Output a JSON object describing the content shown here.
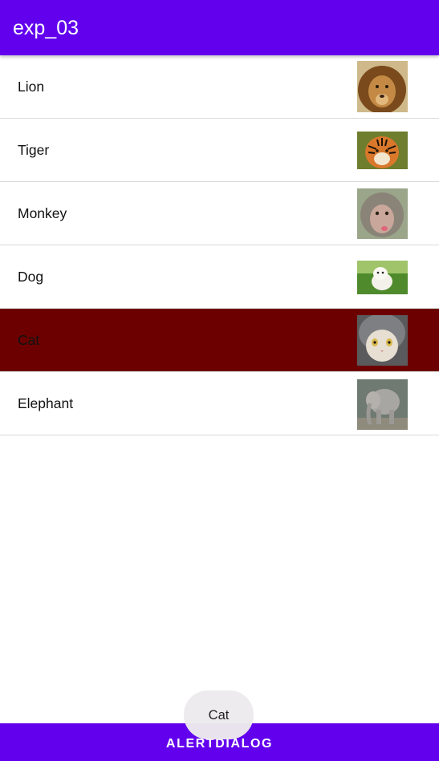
{
  "app": {
    "title": "exp_03"
  },
  "list": {
    "items": [
      {
        "label": "Lion",
        "image": "lion-photo",
        "selected": false
      },
      {
        "label": "Tiger",
        "image": "tiger-photo",
        "selected": false
      },
      {
        "label": "Monkey",
        "image": "monkey-photo",
        "selected": false
      },
      {
        "label": "Dog",
        "image": "dog-photo",
        "selected": false
      },
      {
        "label": "Cat",
        "image": "cat-photo",
        "selected": true
      },
      {
        "label": "Elephant",
        "image": "elephant-photo",
        "selected": false
      }
    ]
  },
  "bottom_button": {
    "label": "ALERTDIALOG"
  },
  "toast": {
    "text": "Cat"
  },
  "colors": {
    "primary": "#6200ee",
    "selected_row": "#6c0000",
    "divider": "#dadada"
  }
}
